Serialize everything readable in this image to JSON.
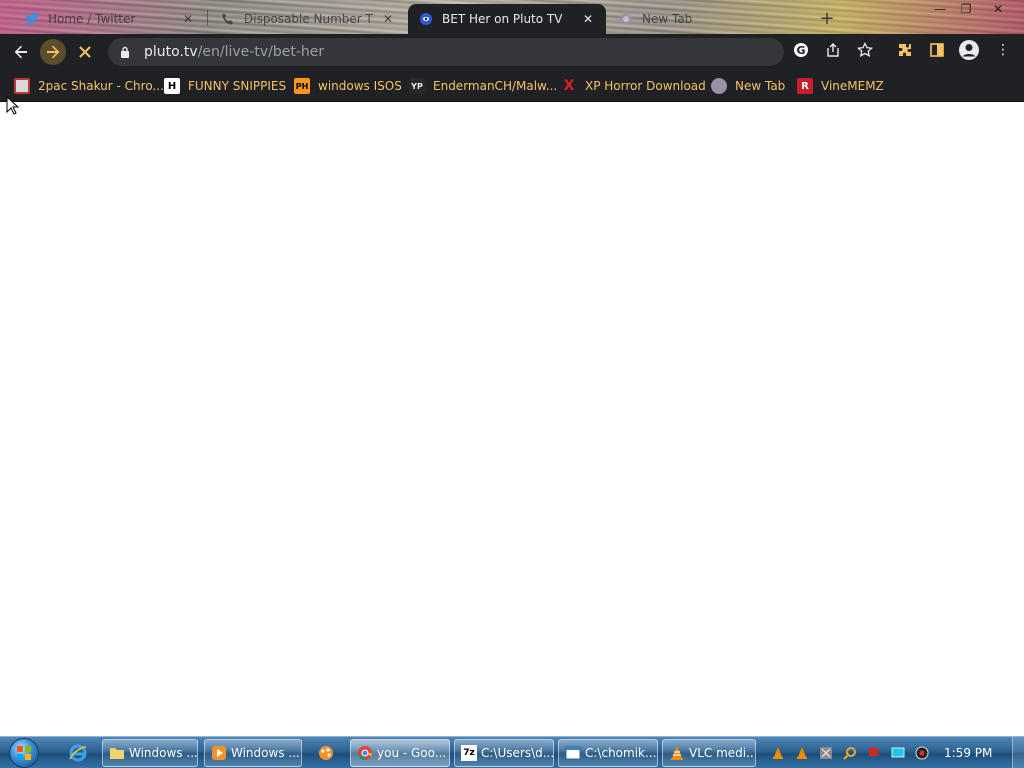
{
  "tabs": [
    {
      "title": "Home / Twitter",
      "icon": "twitter-icon"
    },
    {
      "title": "Disposable Number T",
      "icon": "phone-icon"
    },
    {
      "title": "BET Her on Pluto TV",
      "icon": "pluto-tv-icon",
      "active": true
    },
    {
      "title": "New Tab",
      "icon": "new-tab-icon"
    }
  ],
  "address_bar": {
    "domain": "pluto.tv",
    "path": "/en/live-tv/bet-her"
  },
  "bookmarks": [
    {
      "label": "2pac Shakur - Chro...",
      "icon_text": ""
    },
    {
      "label": "FUNNY SNIPPIES",
      "icon_text": "H"
    },
    {
      "label": "windows ISOS",
      "icon_text": "PH"
    },
    {
      "label": "EndermanCH/Malw...",
      "icon_text": "YP"
    },
    {
      "label": "XP Horror Download",
      "icon_text": "X"
    },
    {
      "label": "New Tab",
      "icon_text": ""
    },
    {
      "label": "VineMEMZ",
      "icon_text": "R"
    }
  ],
  "taskbar": {
    "tasks": [
      {
        "label": "Windows ...",
        "icon": "folder-icon"
      },
      {
        "label": "Windows ...",
        "icon": "media-player-icon"
      },
      {
        "label": "you - Goo...",
        "icon": "chrome-icon",
        "active": true
      },
      {
        "label": "C:\\Users\\d...",
        "icon": "7zip-icon"
      },
      {
        "label": "C:\\chomik...",
        "icon": "window-icon"
      },
      {
        "label": "VLC medi...",
        "icon": "vlc-icon"
      }
    ],
    "clock": "1:59 PM"
  },
  "colors": {
    "chrome_dark": "#202124",
    "omnibox": "#35363a",
    "bookmark_text": "#f5c266",
    "taskbar": "#2d6392"
  }
}
